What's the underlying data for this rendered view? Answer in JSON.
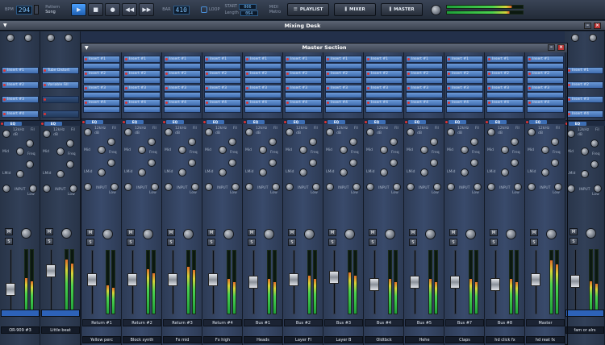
{
  "transport": {
    "bpm_label": "BPM",
    "bpm_value": "294",
    "pattern_label": "Pattern",
    "song_label": "Song",
    "bar_label": "BAR",
    "bar_value": "410",
    "loop_label": "LOOP",
    "start_label": "START",
    "length_label": "Length",
    "start_value": "006",
    "length_value": "064",
    "midi_label": "MIDI",
    "metro_label": "Metro",
    "playlist_label": "PLAYLIST",
    "mixer_label": "MIXER",
    "master_label": "MASTER"
  },
  "desk": {
    "title": "Mixing Desk"
  },
  "master_section": {
    "title": "Master Section"
  },
  "side_strips": [
    {
      "inserts": [
        "Insert #1",
        "Insert #2",
        "Insert #3",
        "Insert #4"
      ],
      "eq_freq": "12kHz",
      "name": "",
      "bottom": "OR-909 #3",
      "fader": 0.35,
      "meter": 0.55
    },
    {
      "inserts": [
        "Tube Distort",
        "Variable Fill",
        "",
        ""
      ],
      "eq_freq": "12kHz",
      "name": "",
      "bottom": "Little beat",
      "fader": 0.7,
      "meter": 0.85
    },
    {
      "inserts": [
        "Insert #1",
        "Insert #2",
        "Insert #3",
        "Insert #4"
      ],
      "eq_freq": "12kHz",
      "name": "",
      "bottom": "fam or alrs",
      "fader": 0.5,
      "meter": 0.5
    }
  ],
  "master_strips": [
    {
      "insert_labels": [
        "Insert #1",
        "Insert #2",
        "Insert #3",
        "Insert #4"
      ],
      "eq_freq": "12kHz",
      "name": "Return #1",
      "bottom": "Yellow perc",
      "fader": 0.55,
      "meter": 0.45
    },
    {
      "insert_labels": [
        "Insert #1",
        "Insert #2",
        "Insert #3",
        "Insert #4"
      ],
      "eq_freq": "12kHz",
      "name": "Return #2",
      "bottom": "Block synth",
      "fader": 0.55,
      "meter": 0.7
    },
    {
      "insert_labels": [
        "Insert #1",
        "Insert #2",
        "Insert #3",
        "Insert #4"
      ],
      "eq_freq": "12kHz",
      "name": "Return #3",
      "bottom": "Fx mid",
      "fader": 0.55,
      "meter": 0.75
    },
    {
      "insert_labels": [
        "Insert #1",
        "Insert #2",
        "Insert #3",
        "Insert #4"
      ],
      "eq_freq": "12kHz",
      "name": "Return #4",
      "bottom": "Fx high",
      "fader": 0.55,
      "meter": 0.55
    },
    {
      "insert_labels": [
        "Insert #1",
        "Insert #2",
        "Insert #3",
        "Insert #4"
      ],
      "eq_freq": "12kHz",
      "name": "Bus #1",
      "bottom": "Heads",
      "fader": 0.5,
      "meter": 0.55
    },
    {
      "insert_labels": [
        "Insert #1",
        "Insert #2",
        "Insert #3",
        "Insert #4"
      ],
      "eq_freq": "12kHz",
      "name": "Bus #2",
      "bottom": "Layer FI",
      "fader": 0.55,
      "meter": 0.6
    },
    {
      "insert_labels": [
        "Insert #1",
        "Insert #2",
        "Insert #3",
        "Insert #4"
      ],
      "eq_freq": "12kHz",
      "name": "Bus #3",
      "bottom": "Layer B",
      "fader": 0.6,
      "meter": 0.65
    },
    {
      "insert_labels": [
        "Insert #1",
        "Insert #2",
        "Insert #3",
        "Insert #4"
      ],
      "eq_freq": "12kHz",
      "name": "Bus #4",
      "bottom": "Oldtbck",
      "fader": 0.45,
      "meter": 0.55
    },
    {
      "insert_labels": [
        "Insert #1",
        "Insert #2",
        "Insert #3",
        "Insert #4"
      ],
      "eq_freq": "12kHz",
      "name": "Bus #5",
      "bottom": "Hehe",
      "fader": 0.5,
      "meter": 0.55
    },
    {
      "insert_labels": [
        "Insert #1",
        "Insert #2",
        "Insert #3",
        "Insert #4"
      ],
      "eq_freq": "12kHz",
      "name": "Bus #7",
      "bottom": "Claps",
      "fader": 0.5,
      "meter": 0.55
    },
    {
      "insert_labels": [
        "Insert #1",
        "Insert #2",
        "Insert #3",
        "Insert #4"
      ],
      "eq_freq": "12kHz",
      "name": "Bus #8",
      "bottom": "hd click fx",
      "fader": 0.45,
      "meter": 0.55
    },
    {
      "insert_labels": [
        "Insert #1",
        "Insert #2",
        "Insert #3",
        "Insert #4"
      ],
      "eq_freq": "12kHz",
      "name": "Master",
      "bottom": "hd reat fx",
      "fader": 0.55,
      "meter": 0.85
    }
  ],
  "eq_labels": {
    "eq": "EQ",
    "db": "dB",
    "fil": "Fil",
    "freq": "Freq",
    "high": "High",
    "mid": "Mid",
    "low": "Low",
    "lmid": "LMid",
    "input": "INPUT",
    "m": "M",
    "s": "S"
  },
  "colors": {
    "accent": "#3d6eb4",
    "insert": "#5585c5",
    "background": "#23304a"
  }
}
